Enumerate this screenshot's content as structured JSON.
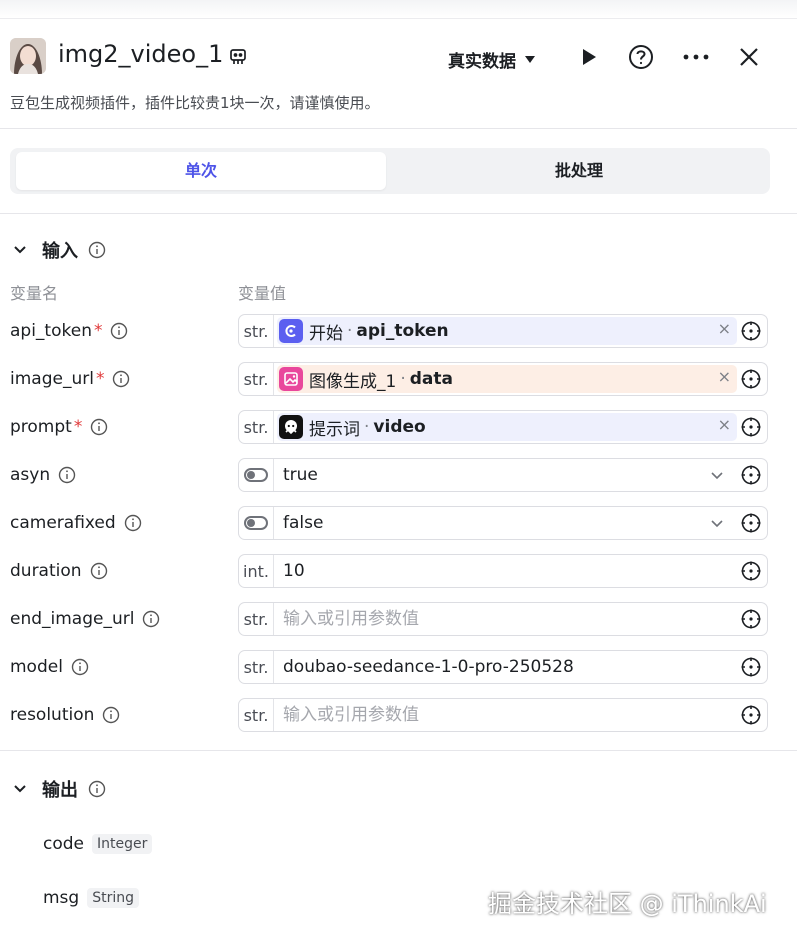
{
  "header": {
    "title": "img2_video_1",
    "data_mode": "真实数据",
    "description": "豆包生成视频插件，插件比较贵1块一次，请谨慎使用。"
  },
  "tabs": [
    {
      "label": "单次",
      "active": true
    },
    {
      "label": "批处理",
      "active": false
    }
  ],
  "input_section": {
    "title": "输入",
    "col_name": "变量名",
    "col_value": "变量值",
    "rows": [
      {
        "name": "api_token",
        "required": true,
        "type": "str.",
        "kind": "ref",
        "node": "开始",
        "var": "api_token",
        "chip_bg": "#eef0fd",
        "icon_bg": "#5b5ff0"
      },
      {
        "name": "image_url",
        "required": true,
        "type": "str.",
        "kind": "ref",
        "node": "图像生成_1",
        "var": "data",
        "chip_bg": "#fdeee5",
        "icon_bg": "#e9479c"
      },
      {
        "name": "prompt",
        "required": true,
        "type": "str.",
        "kind": "ref",
        "node": "提示词",
        "var": "video",
        "chip_bg": "#eef0fd",
        "icon_bg": "#111111"
      },
      {
        "name": "asyn",
        "required": false,
        "type": "toggle",
        "kind": "select",
        "value": "true"
      },
      {
        "name": "camerafixed",
        "required": false,
        "type": "toggle",
        "kind": "select",
        "value": "false"
      },
      {
        "name": "duration",
        "required": false,
        "type": "int.",
        "kind": "text",
        "value": "10"
      },
      {
        "name": "end_image_url",
        "required": false,
        "type": "str.",
        "kind": "placeholder",
        "value": "输入或引用参数值"
      },
      {
        "name": "model",
        "required": false,
        "type": "str.",
        "kind": "text",
        "value": "doubao-seedance-1-0-pro-250528"
      },
      {
        "name": "resolution",
        "required": false,
        "type": "str.",
        "kind": "placeholder",
        "value": "输入或引用参数值"
      }
    ]
  },
  "output_section": {
    "title": "输出",
    "fields": [
      {
        "name": "code",
        "type": "Integer"
      },
      {
        "name": "msg",
        "type": "String"
      }
    ]
  },
  "watermark": "掘金技术社区 @ iThinkAi",
  "colors": {
    "accent": "#4d53e8",
    "required": "#e0393a"
  }
}
